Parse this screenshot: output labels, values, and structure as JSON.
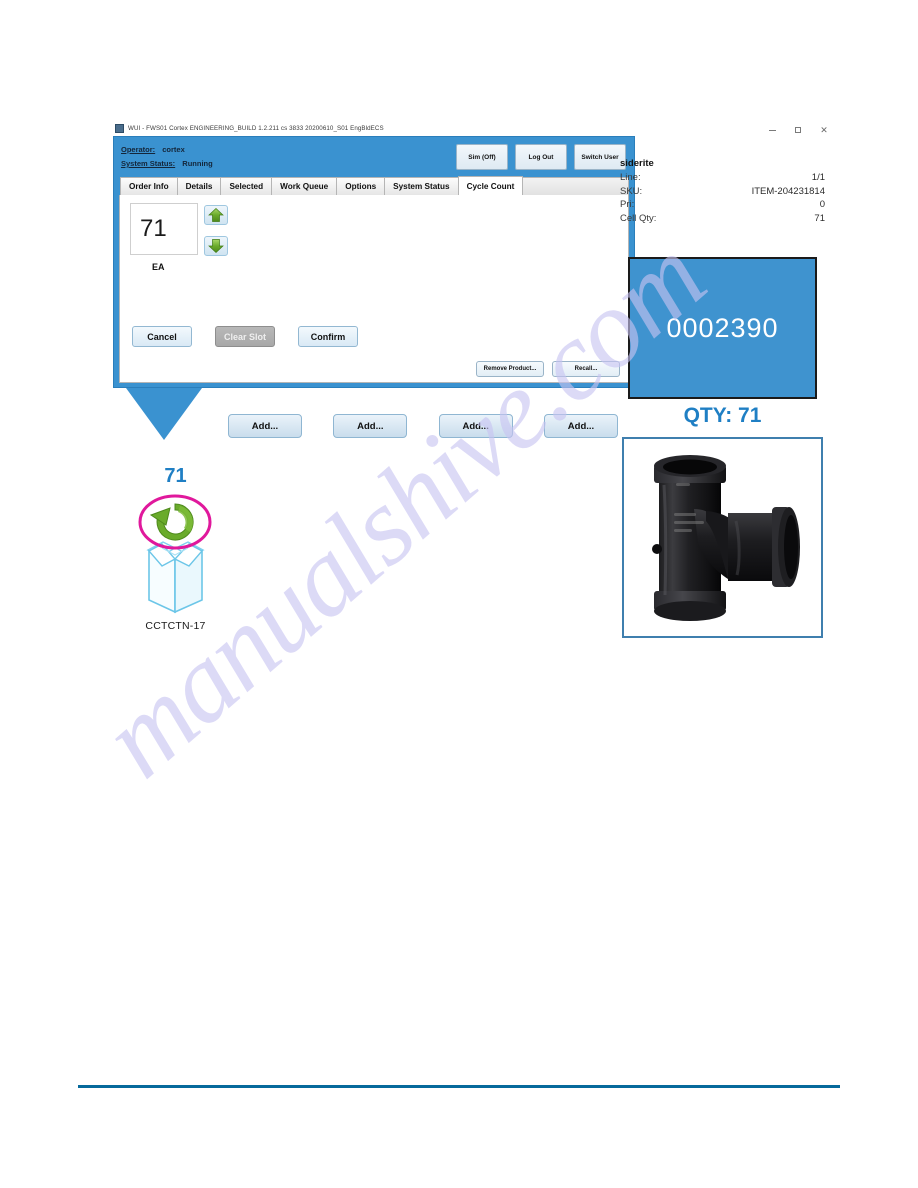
{
  "window": {
    "title": "WUI - FWS01 Cortex ENGINEERING_BUILD 1.2.211 cs 3833  20200610_S01 EngBldECS",
    "app_icon": "application-icon",
    "controls": {
      "minimize": "minimize-icon",
      "maximize": "maximize-icon",
      "close": "close-icon"
    }
  },
  "header": {
    "operator_label": "Operator:",
    "operator_value": "cortex",
    "system_status_label": "System Status:",
    "system_status_value": "Running",
    "buttons": [
      {
        "label": "Sim (Off)",
        "name": "sim-toggle-button"
      },
      {
        "label": "Log Out",
        "name": "log-out-button"
      },
      {
        "label": "Switch User",
        "name": "switch-user-button"
      }
    ]
  },
  "tabs": [
    {
      "label": "Order Info",
      "active": false
    },
    {
      "label": "Details",
      "active": false
    },
    {
      "label": "Selected",
      "active": false
    },
    {
      "label": "Work Queue",
      "active": false
    },
    {
      "label": "Options",
      "active": false
    },
    {
      "label": "System Status",
      "active": false
    },
    {
      "label": "Cycle Count",
      "active": true
    }
  ],
  "panel": {
    "quantity_value": "71",
    "unit_label": "EA",
    "spinner_up": "arrow-up-icon",
    "spinner_down": "arrow-down-icon",
    "actions": [
      {
        "label": "Cancel",
        "name": "cancel-button",
        "disabled": false
      },
      {
        "label": "Clear Slot",
        "name": "clear-slot-button",
        "disabled": true
      },
      {
        "label": "Confirm",
        "name": "confirm-button",
        "disabled": false
      }
    ],
    "secondary_actions": [
      {
        "label": "Remove Product...",
        "name": "remove-product-button"
      },
      {
        "label": "Recall...",
        "name": "recall-button"
      }
    ]
  },
  "add_buttons": [
    {
      "label": "Add..."
    },
    {
      "label": "Add..."
    },
    {
      "label": "Add..."
    },
    {
      "label": "Add..."
    }
  ],
  "carton": {
    "quantity": "71",
    "label": "CCTCTN-17",
    "badge_icon": "refresh-arrow-icon",
    "box_icon": "open-carton-icon"
  },
  "info": {
    "item_name": "siderite",
    "rows": [
      {
        "key": "Line:",
        "value": "1/1"
      },
      {
        "key": "SKU:",
        "value": "ITEM-204231814"
      },
      {
        "key": "Pri:",
        "value": "0"
      },
      {
        "key": "Cell Qty:",
        "value": "71"
      }
    ]
  },
  "display": {
    "number": "0002390",
    "qty_caption": "QTY: 71"
  },
  "product_photo": {
    "alt": "black-sanitary-tee-pipe-fitting"
  },
  "watermark": {
    "text": "manualshive.com"
  },
  "colors": {
    "app_blue": "#3a92d0",
    "accent_blue": "#1f7fc4",
    "rule_blue": "#06699b",
    "badge_magenta": "#e0189c",
    "arrow_green": "#6aab2b"
  }
}
